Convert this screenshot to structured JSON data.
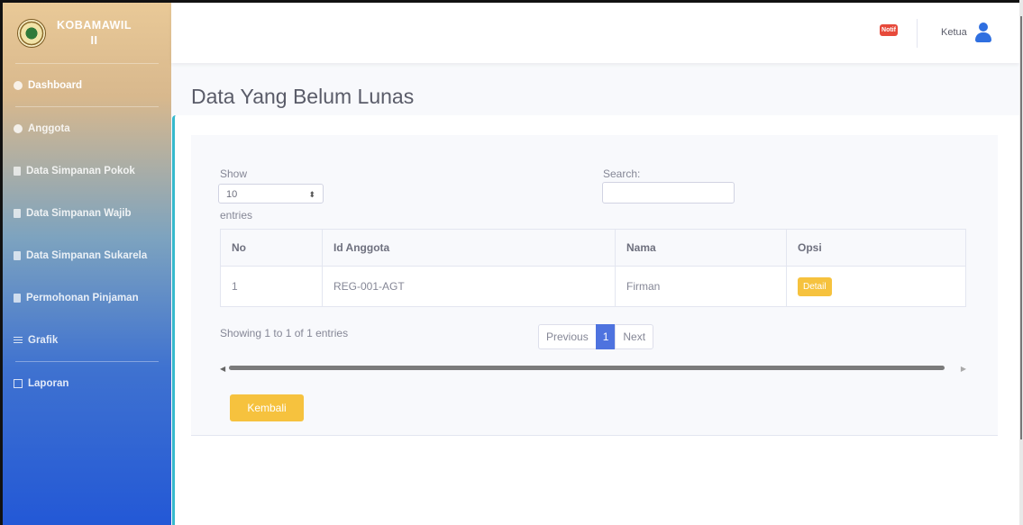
{
  "brand": {
    "line1": "KOBAMAWIL",
    "line2": "II"
  },
  "sidebar": {
    "items": [
      {
        "label": "Dashboard",
        "icon": "dashboard-icon"
      },
      {
        "label": "Anggota",
        "icon": "user-icon"
      },
      {
        "label": "Data Simpanan Pokok",
        "icon": "document-icon"
      },
      {
        "label": "Data Simpanan Wajib",
        "icon": "document-icon"
      },
      {
        "label": "Data Simpanan Sukarela",
        "icon": "document-icon"
      },
      {
        "label": "Permohonan Pinjaman",
        "icon": "file-icon"
      },
      {
        "label": "Grafik",
        "icon": "list-icon"
      },
      {
        "label": "Laporan",
        "icon": "table-icon"
      }
    ]
  },
  "topbar": {
    "notif_label": "Notif",
    "user_name": "Ketua"
  },
  "page": {
    "title": "Data Yang Belum Lunas"
  },
  "table_controls": {
    "show_label": "Show",
    "entries_value": "10",
    "entries_label": "entries",
    "search_label": "Search:",
    "search_value": ""
  },
  "table": {
    "headers": [
      "No",
      "Id Anggota",
      "Nama",
      "Opsi"
    ],
    "rows": [
      {
        "no": "1",
        "id_anggota": "REG-001-AGT",
        "nama": "Firman",
        "opsi": "Detail"
      }
    ]
  },
  "pagination": {
    "info": "Showing 1 to 1 of 1 entries",
    "previous": "Previous",
    "current": "1",
    "next": "Next"
  },
  "actions": {
    "back_label": "Kembali"
  },
  "colors": {
    "primary": "#4e73df",
    "warning": "#f6c23e",
    "danger": "#e74a3b",
    "info": "#36b9cc"
  }
}
